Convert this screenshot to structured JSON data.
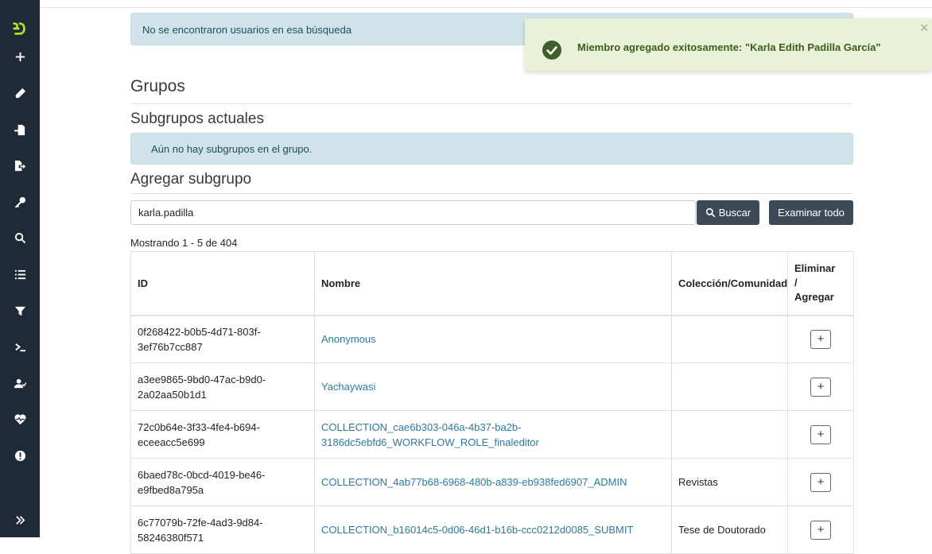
{
  "sidebar": {
    "logo": "dspace-logo-icon",
    "items": [
      {
        "name": "sidebar-item-new",
        "icon": "plus-icon"
      },
      {
        "name": "sidebar-item-edit",
        "icon": "pencil-icon"
      },
      {
        "name": "sidebar-item-import",
        "icon": "file-import-icon"
      },
      {
        "name": "sidebar-item-export",
        "icon": "file-export-icon"
      },
      {
        "name": "sidebar-item-access-control",
        "icon": "key-icon"
      },
      {
        "name": "sidebar-item-search",
        "icon": "search-icon"
      },
      {
        "name": "sidebar-item-registries",
        "icon": "list-icon"
      },
      {
        "name": "sidebar-item-curation",
        "icon": "filter-icon"
      },
      {
        "name": "sidebar-item-processes",
        "icon": "terminal-icon"
      },
      {
        "name": "sidebar-item-workflow",
        "icon": "user-check-icon"
      },
      {
        "name": "sidebar-item-health",
        "icon": "heartbeat-icon"
      },
      {
        "name": "sidebar-item-notifications",
        "icon": "exclamation-circle-icon"
      }
    ],
    "expand_icon": "double-chevron-right-icon"
  },
  "alerts": {
    "no_users": "No se encontraron usuarios en esa búsqueda",
    "no_subgroups": "Aún no hay subgrupos en el grupo."
  },
  "toast": {
    "message": "Miembro agregado exitosamente: \"Karla Edith Padilla García\"",
    "close": "×",
    "color": "#e9f1d9"
  },
  "headings": {
    "groups": "Grupos",
    "current_subgroups": "Subgrupos actuales",
    "add_subgroup": "Agregar subgrupo"
  },
  "search": {
    "value": "karla.padilla",
    "search_label": "Buscar",
    "browse_label": "Examinar todo"
  },
  "results": {
    "info": "Mostrando 1 - 5 de 404",
    "columns": [
      "ID",
      "Nombre",
      "Colección/Comunidad",
      "Eliminar / Agregar"
    ],
    "rows": [
      {
        "id": "0f268422-b0b5-4d71-803f-3ef76b7cc887",
        "name": "Anonymous",
        "collection": "",
        "action": "+"
      },
      {
        "id": "a3ee9865-9bd0-47ac-b9d0-2a02aa50b1d1",
        "name": "Yachaywasi",
        "collection": "",
        "action": "+"
      },
      {
        "id": "72c0b64e-3f33-4fe4-b694-eceeacc5e699",
        "name": "COLLECTION_cae6b303-046a-4b37-ba2b-3186dc5ebfd6_WORKFLOW_ROLE_finaleditor",
        "collection": "",
        "action": "+"
      },
      {
        "id": "6baed78c-0bcd-4019-be46-e9fbed8a795a",
        "name": "COLLECTION_4ab77b68-6968-480b-a839-eb938fed6907_ADMIN",
        "collection": "Revistas",
        "action": "+"
      },
      {
        "id": "6c77079b-72fe-4ad3-9d84-58246380f571",
        "name": "COLLECTION_b16014c5-0d06-46d1-b16b-ccc0212d0085_SUBMIT",
        "collection": "Tese de Doutorado",
        "action": "+"
      }
    ]
  },
  "colors": {
    "sidebar": "#1f2a36",
    "accent_green": "#a6e22e",
    "info_alert": "#d1e3ea",
    "link": "#2c7a9e",
    "dark_button": "#3d4a55"
  }
}
